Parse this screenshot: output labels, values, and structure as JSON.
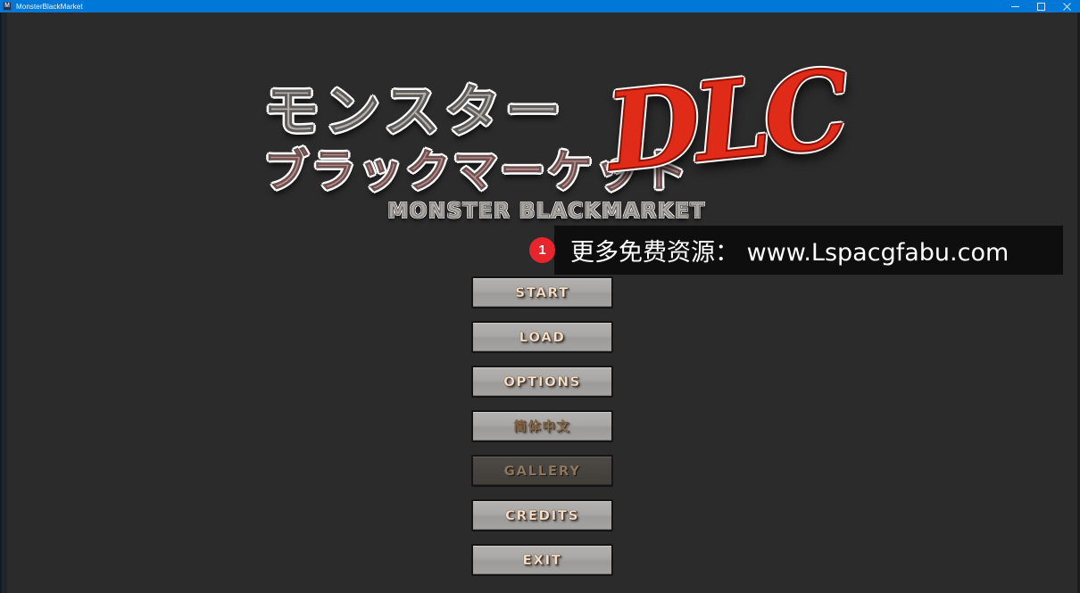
{
  "titlebar": {
    "app_icon": "app-icon-m",
    "icon_letter": "M",
    "title": "MonsterBlackMarket",
    "accent_color": "#0078d7",
    "controls": [
      {
        "name": "minimize",
        "glyph": "─"
      },
      {
        "name": "maximize",
        "glyph": "□"
      },
      {
        "name": "close",
        "glyph": "✕"
      }
    ]
  },
  "logo": {
    "japanese_top": "モンスター",
    "japanese_bottom": "ブラックマーケット",
    "dlc": "DLC",
    "english_subtitle": "MONSTER BLACKMARKET",
    "dlc_color": "#e02b18",
    "top_color": "#b3b0ac",
    "bottom_color": "#c08c8c"
  },
  "ad_banner": {
    "badge_count": "1",
    "badge_color": "#e8252c",
    "text": "更多免费资源： www.Lspacgfabu.com",
    "background": "#0e0e0e"
  },
  "menu": {
    "buttons": [
      {
        "label": "START",
        "name": "start",
        "disabled": false
      },
      {
        "label": "LOAD",
        "name": "load",
        "disabled": false
      },
      {
        "label": "OPTIONS",
        "name": "options",
        "disabled": false
      },
      {
        "label": "简体中文",
        "name": "language",
        "disabled": false
      },
      {
        "label": "GALLERY",
        "name": "gallery",
        "disabled": true
      },
      {
        "label": "CREDITS",
        "name": "credits",
        "disabled": false
      },
      {
        "label": "EXIT",
        "name": "exit",
        "disabled": false
      }
    ]
  },
  "canvas": {
    "background_color": "#2b2b2b"
  }
}
